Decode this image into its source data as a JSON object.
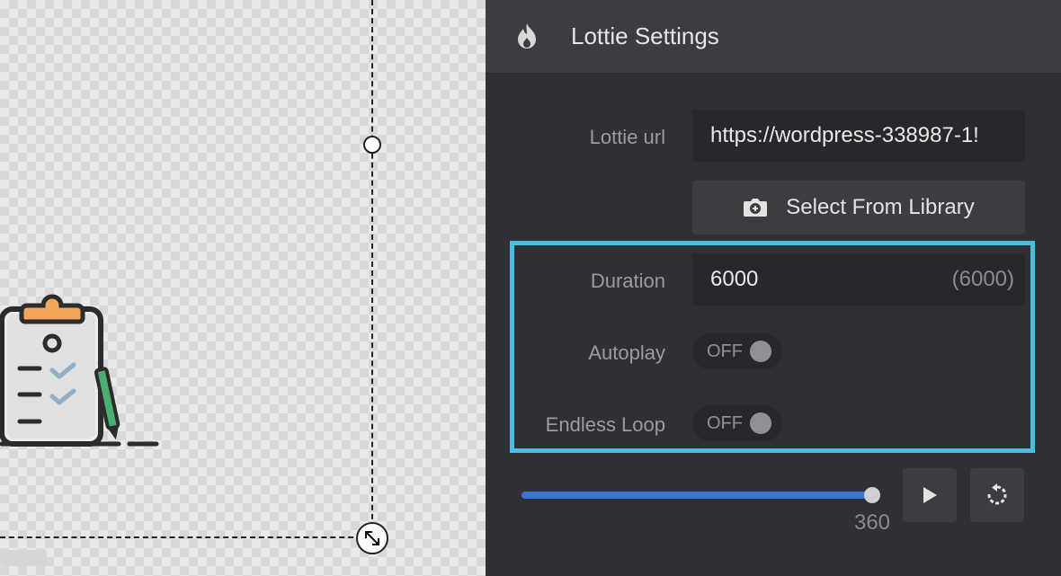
{
  "panel": {
    "title": "Lottie Settings",
    "header_icon": "flame-icon",
    "lottie_url": {
      "label": "Lottie url",
      "value": "https://wordpress-338987-1!"
    },
    "library_button": {
      "label": "Select From Library",
      "icon": "camera-icon"
    },
    "duration": {
      "label": "Duration",
      "value": "6000",
      "default_hint": "(6000)"
    },
    "autoplay": {
      "label": "Autoplay",
      "state": "OFF"
    },
    "endless_loop": {
      "label": "Endless Loop",
      "state": "OFF"
    },
    "timeline": {
      "value": 360,
      "value_label": "360",
      "fraction": 1.0
    },
    "controls": {
      "play_icon": "play-icon",
      "reset_icon": "reset-icon"
    }
  },
  "colors": {
    "highlight": "#4bbde0",
    "slider_fill": "#3b73d8",
    "panel_bg": "#2f3033",
    "header_bg": "#3c3d41"
  }
}
